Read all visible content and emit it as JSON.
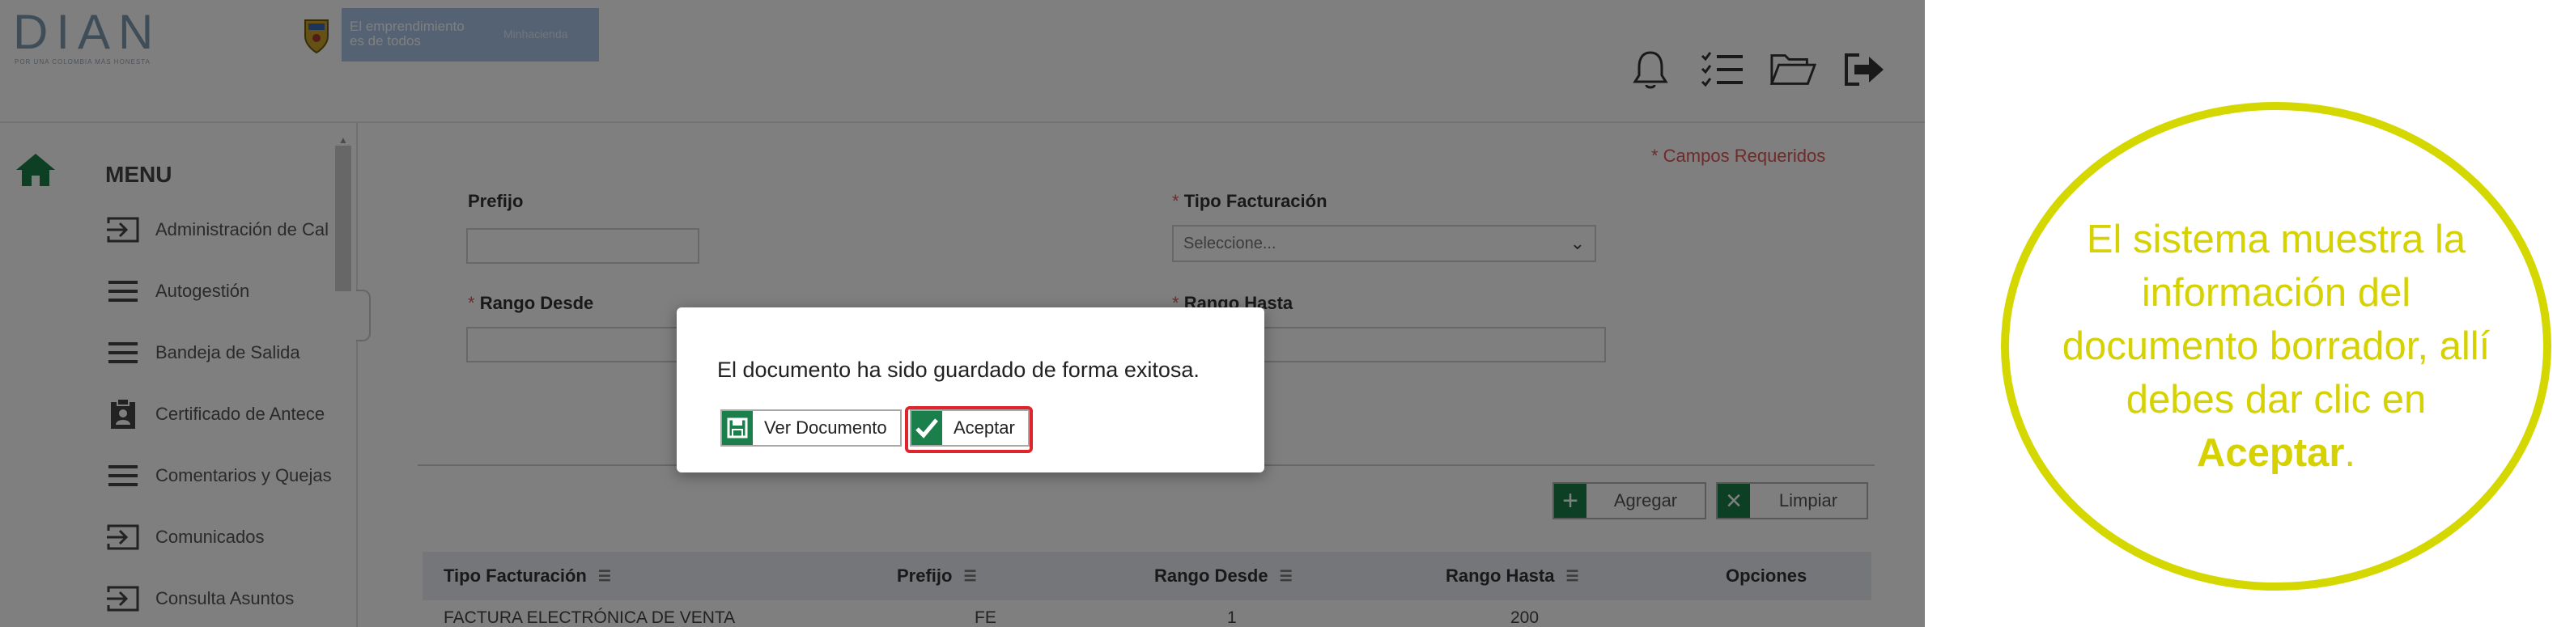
{
  "header": {
    "logo_text": "DIAN",
    "logo_tagline": "POR UNA COLOMBIA MÁS HONESTA",
    "banner_line1": "El emprendimiento es de todos",
    "banner_line2": "Minhacienda"
  },
  "topbar_icons": [
    "bell-icon",
    "checklist-icon",
    "folder-open-icon",
    "sign-out-icon"
  ],
  "sidebar": {
    "title": "MENU",
    "items": [
      {
        "label": "Administración de Cal",
        "icon": "enter-icon"
      },
      {
        "label": "Autogestión",
        "icon": "list-icon"
      },
      {
        "label": "Bandeja de Salida",
        "icon": "list-icon"
      },
      {
        "label": "Certificado de Antece",
        "icon": "clipboard-icon"
      },
      {
        "label": "Comentarios y Quejas",
        "icon": "list-icon"
      },
      {
        "label": "Comunicados",
        "icon": "enter-icon"
      },
      {
        "label": "Consulta Asuntos",
        "icon": "enter-icon"
      }
    ]
  },
  "form": {
    "required_note": "* Campos Requeridos",
    "prefijo_label": "Prefijo",
    "tipo_label": "Tipo Facturación",
    "tipo_placeholder": "Seleccione...",
    "rango_desde_label": "Rango Desde",
    "rango_hasta_label": "Rango Hasta",
    "required_mark": "*"
  },
  "actions": {
    "agregar": "Agregar",
    "limpiar": "Limpiar"
  },
  "table": {
    "columns": [
      "Tipo Facturación",
      "Prefijo",
      "Rango Desde",
      "Rango Hasta",
      "Opciones"
    ],
    "rows": [
      [
        "FACTURA ELECTRÓNICA DE VENTA",
        "FE",
        "1",
        "200",
        ""
      ]
    ]
  },
  "modal": {
    "message": "El documento ha sido guardado de forma exitosa.",
    "ver_label": "Ver Documento",
    "aceptar_label": "Aceptar"
  },
  "callout": {
    "text_before": "El sistema muestra la información del documento borrador, allí debes dar clic en ",
    "text_bold": "Aceptar",
    "text_after": "."
  },
  "colors": {
    "accent_green": "#1a7f4b",
    "callout_yellow": "#d6d100",
    "highlight_red": "#e0242b",
    "required_red": "#e05555"
  }
}
